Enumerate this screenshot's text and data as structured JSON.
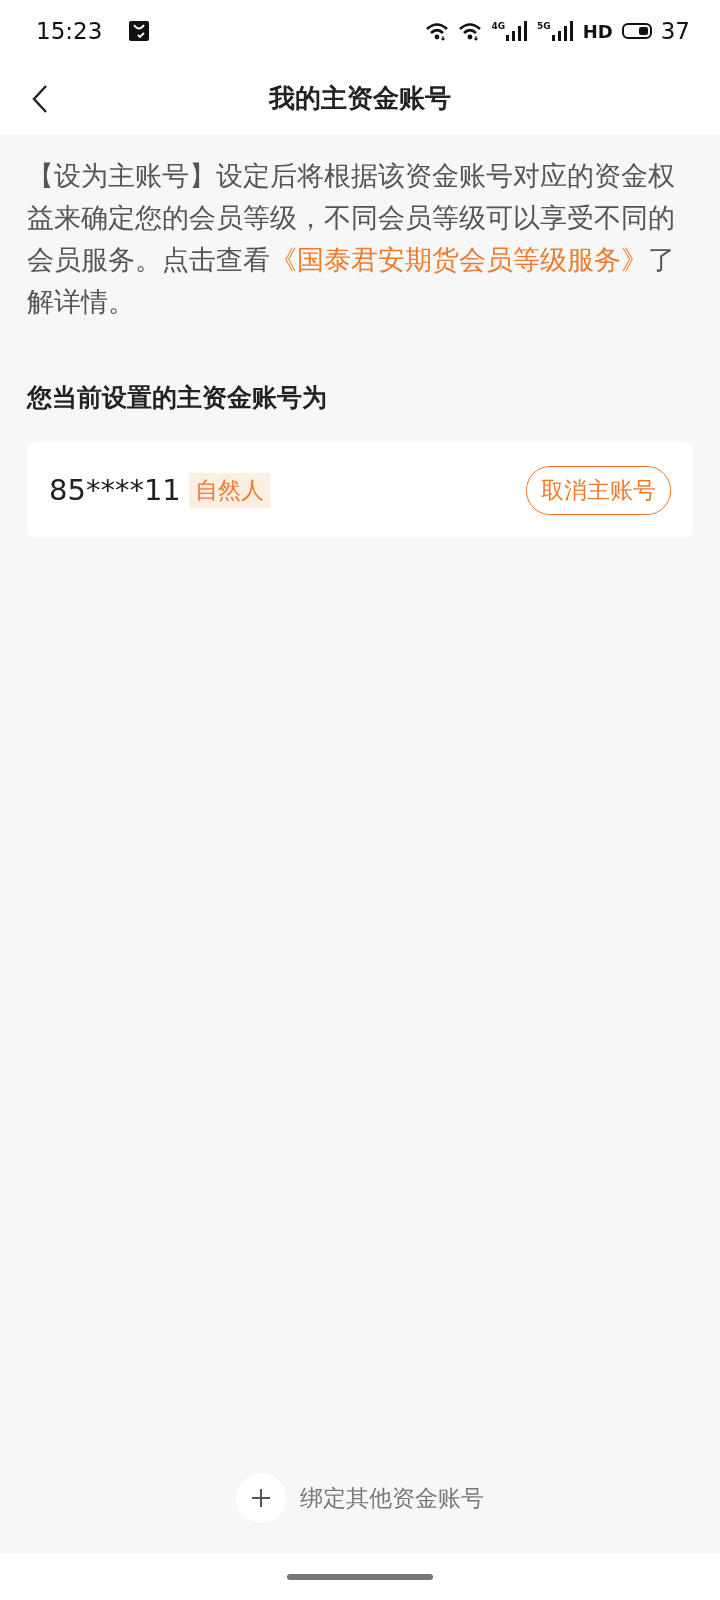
{
  "status_bar": {
    "time": "15:23",
    "signals": [
      {
        "label": "4G"
      },
      {
        "label": "5G"
      }
    ],
    "hd": "HD",
    "battery": "37"
  },
  "header": {
    "title": "我的主资金账号"
  },
  "intro": {
    "before": "【设为主账号】设定后将根据该资金账号对应的资金权益来确定您的会员等级，不同会员等级可以享受不同的会员服务。点击查看",
    "link": "《国泰君安期货会员等级服务》",
    "after": "了解详情。"
  },
  "section_title": "您当前设置的主资金账号为",
  "account": {
    "number": "85****11",
    "tag": "自然人",
    "action": "取消主账号"
  },
  "bind_button": {
    "label": "绑定其他资金账号"
  }
}
